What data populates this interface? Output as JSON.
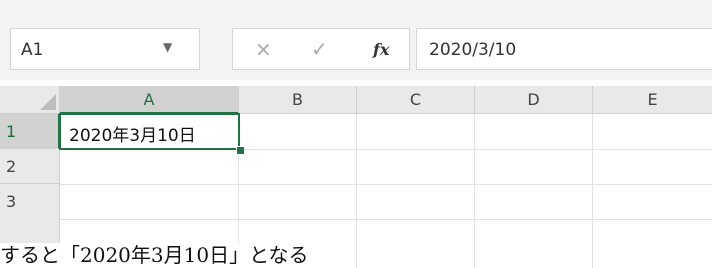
{
  "name_box": {
    "value": "A1"
  },
  "formula_bar": {
    "separator": "⋮",
    "cancel_icon": "×",
    "enter_icon": "✓",
    "fx_label": "fx",
    "value": "2020/3/10"
  },
  "columns": [
    "A",
    "B",
    "C",
    "D",
    "E"
  ],
  "rows": [
    "1",
    "2",
    "3"
  ],
  "cells": {
    "A1": "2020年3月10日"
  },
  "caption": "すると「2020年3月10日」となる",
  "colors": {
    "accent": "#217346",
    "header_bg": "#e9e9e9",
    "selected_header_bg": "#d2d2d2"
  }
}
